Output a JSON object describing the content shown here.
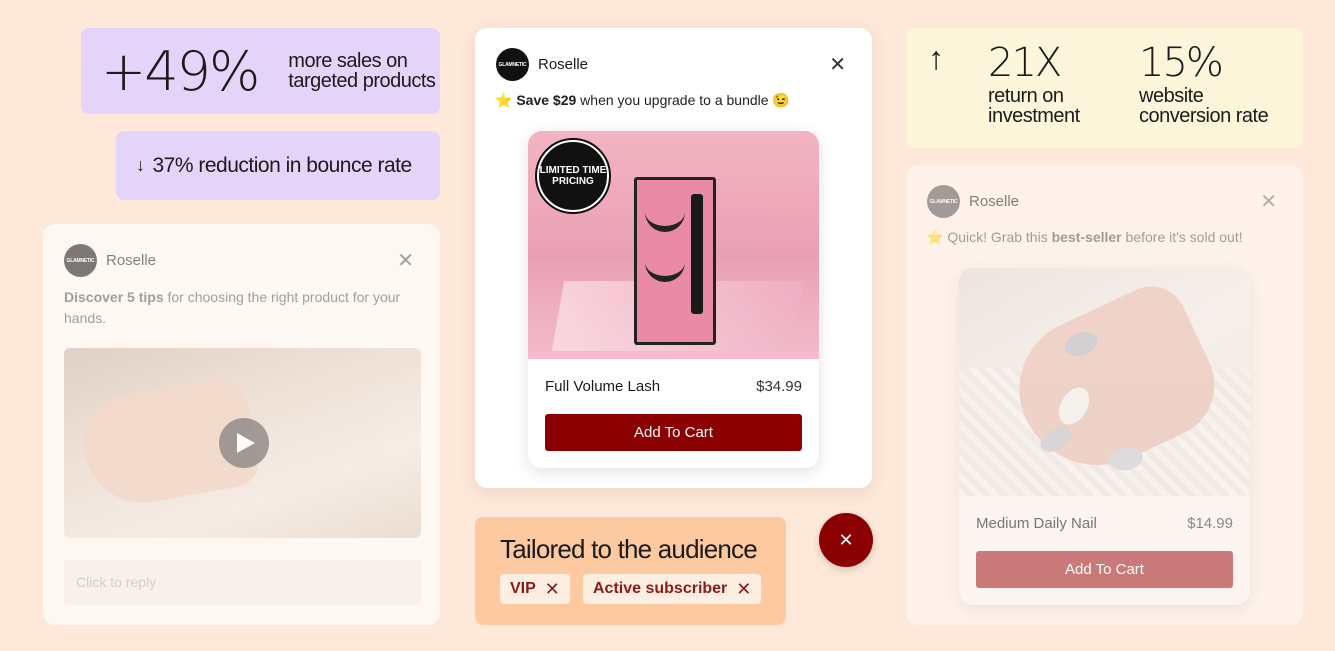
{
  "stats": {
    "sales": {
      "value": "+49%",
      "label_line1": "more sales on",
      "label_line2": "targeted products"
    },
    "bounce": {
      "arrow": "↓",
      "text": "37% reduction in bounce rate"
    },
    "roi": {
      "arrow": "↑",
      "value": "21X",
      "label_line1": "return on",
      "label_line2": "investment"
    },
    "conversion": {
      "value": "15%",
      "label_line1": "website",
      "label_line2": "conversion rate"
    }
  },
  "brand": {
    "name": "Roselle",
    "logo_text": "GLAMNETIC"
  },
  "card_left": {
    "bold": "Discover 5 tips",
    "message": " for choosing the right product for your hands.",
    "reply_placeholder": "Click to reply"
  },
  "card_center": {
    "star": "⭐",
    "bold": "Save $29",
    "message": " when you upgrade to a bundle 😉",
    "badge": "LIMITED TIME PRICING",
    "product_name": "Full Volume Lash",
    "product_price": "$34.99",
    "cta": "Add To Cart"
  },
  "card_right": {
    "star": "⭐",
    "msg_prefix": " Quick! Grab this ",
    "bold": "best-seller",
    "msg_suffix": " before it's sold out!",
    "product_name": "Medium Daily Nail",
    "product_price": "$14.99",
    "cta": "Add To Cart"
  },
  "tailored": {
    "title": "Tailored to the audience",
    "chips": [
      "VIP",
      "Active subscriber"
    ]
  },
  "icons": {
    "close": "✕",
    "play": "play-icon"
  },
  "colors": {
    "accent": "#8b0000",
    "purple": "#e5d4f9",
    "yellow": "#fdf6da",
    "peach": "#fdc9a0"
  }
}
